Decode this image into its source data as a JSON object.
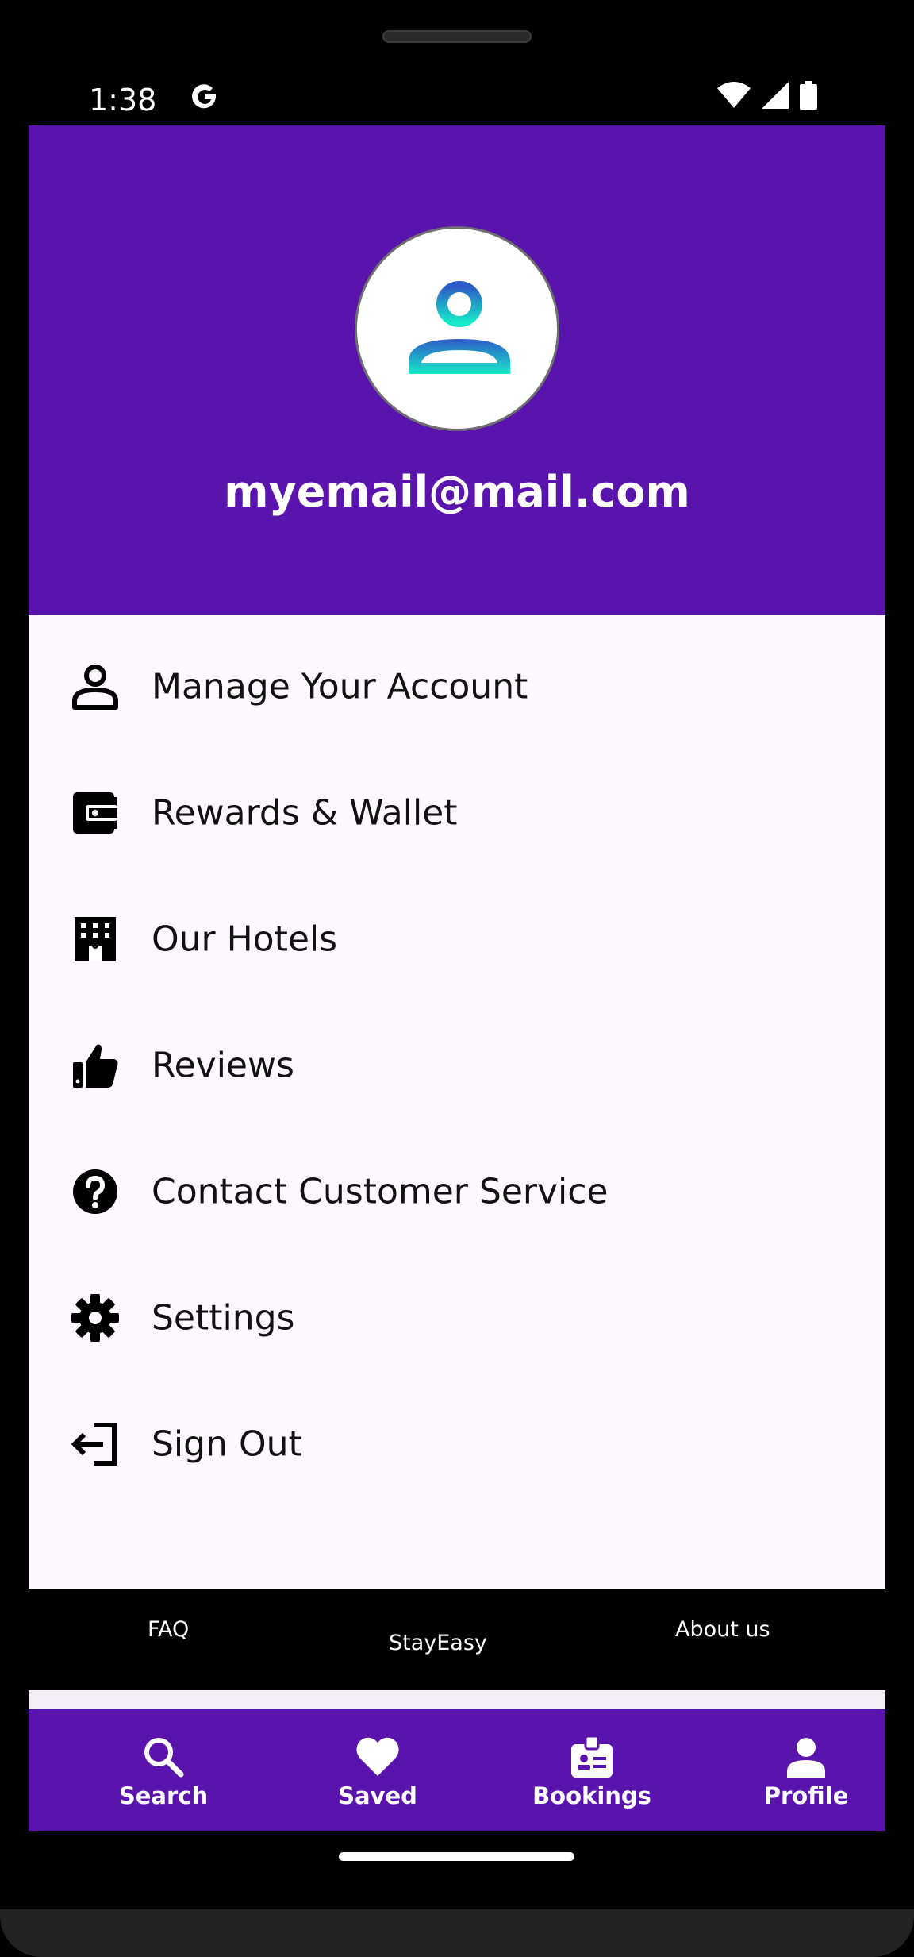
{
  "status_bar": {
    "time": "1:38",
    "icons": [
      "google-icon",
      "wifi-icon",
      "signal-icon",
      "battery-icon"
    ]
  },
  "profile": {
    "email": "myemail@mail.com",
    "avatar_icon": "person-icon"
  },
  "menu": {
    "items": [
      {
        "label": "Manage Your Account",
        "icon": "person-outline-icon"
      },
      {
        "label": "Rewards & Wallet",
        "icon": "wallet-icon"
      },
      {
        "label": "Our Hotels",
        "icon": "hotel-icon"
      },
      {
        "label": "Reviews",
        "icon": "thumb-up-icon"
      },
      {
        "label": "Contact Customer Service",
        "icon": "help-circle-icon"
      },
      {
        "label": "Settings",
        "icon": "gear-icon"
      },
      {
        "label": "Sign Out",
        "icon": "logout-icon"
      }
    ]
  },
  "footer": {
    "faq": "FAQ",
    "brand": "StayEasy",
    "about": "About us"
  },
  "bottom_nav": {
    "items": [
      {
        "label": "Search",
        "icon": "search-icon"
      },
      {
        "label": "Saved",
        "icon": "heart-icon"
      },
      {
        "label": "Bookings",
        "icon": "badge-icon"
      },
      {
        "label": "Profile",
        "icon": "person-icon"
      }
    ]
  },
  "colors": {
    "primary": "#5a13ac",
    "menu_background": "#fdf8fd",
    "footer_background": "#000000"
  }
}
